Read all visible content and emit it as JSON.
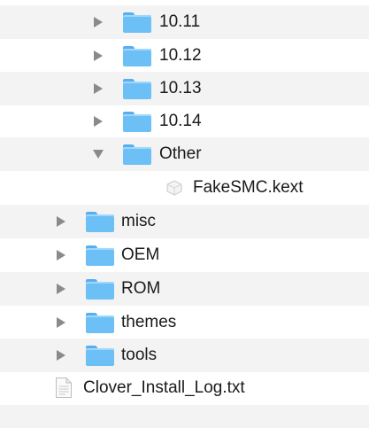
{
  "items": [
    {
      "label": "10.11",
      "kind": "folder",
      "expanded": false
    },
    {
      "label": "10.12",
      "kind": "folder",
      "expanded": false
    },
    {
      "label": "10.13",
      "kind": "folder",
      "expanded": false
    },
    {
      "label": "10.14",
      "kind": "folder",
      "expanded": false
    },
    {
      "label": "Other",
      "kind": "folder",
      "expanded": true
    },
    {
      "label": "FakeSMC.kext",
      "kind": "kext-bundle"
    },
    {
      "label": "misc",
      "kind": "folder",
      "expanded": false
    },
    {
      "label": "OEM",
      "kind": "folder",
      "expanded": false
    },
    {
      "label": "ROM",
      "kind": "folder",
      "expanded": false
    },
    {
      "label": "themes",
      "kind": "folder",
      "expanded": false
    },
    {
      "label": "tools",
      "kind": "folder",
      "expanded": false
    },
    {
      "label": "Clover_Install_Log.txt",
      "kind": "text-file"
    }
  ],
  "colors": {
    "folder": "#6cc0f6",
    "folder_tab": "#58aef0",
    "disclosure_triangle": "#8a8a8a",
    "alt_row": "#f3f3f3"
  }
}
